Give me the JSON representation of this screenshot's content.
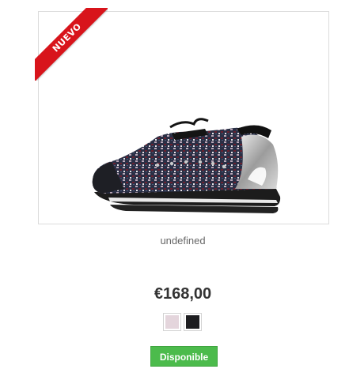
{
  "product": {
    "badge_label": "NUEVO",
    "name": "undefined",
    "price": "€168,00",
    "availability": "Disponible"
  },
  "swatches": [
    {
      "name": "light-pink",
      "color": "#e4d5dc"
    },
    {
      "name": "black",
      "color": "#1d1d20"
    }
  ],
  "colors": {
    "ribbon": "#d8141b",
    "availability_bg": "#4cbb4c"
  }
}
